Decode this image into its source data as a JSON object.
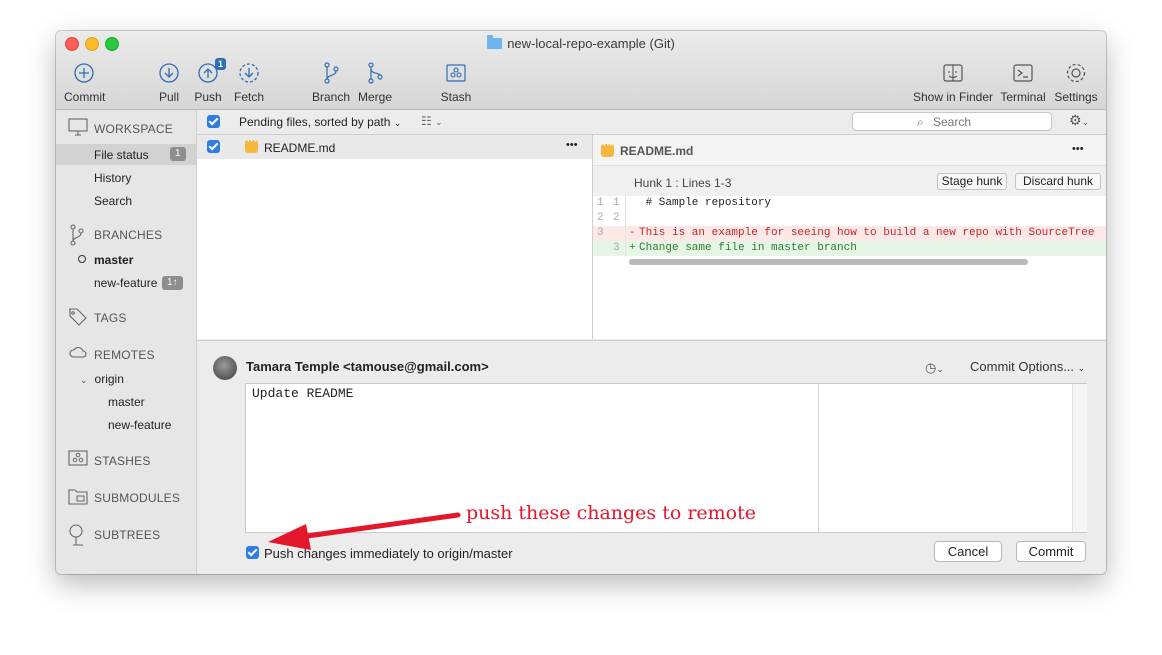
{
  "window": {
    "title": "new-local-repo-example (Git)"
  },
  "toolbar": {
    "commit": "Commit",
    "pull": "Pull",
    "push": "Push",
    "push_badge": "1",
    "fetch": "Fetch",
    "branch": "Branch",
    "merge": "Merge",
    "stash": "Stash",
    "show_in_finder": "Show in Finder",
    "terminal": "Terminal",
    "settings": "Settings"
  },
  "filterbar": {
    "sort_label": "Pending files, sorted by path",
    "search_placeholder": "Search"
  },
  "sidebar": {
    "workspace": "WORKSPACE",
    "file_status": "File status",
    "file_status_count": "1",
    "history": "History",
    "search": "Search",
    "branches": "BRANCHES",
    "branch_master": "master",
    "branch_new_feature": "new-feature",
    "branch_new_feature_badge": "1↑",
    "tags": "TAGS",
    "remotes": "REMOTES",
    "remote_origin": "origin",
    "remote_master": "master",
    "remote_new_feature": "new-feature",
    "stashes": "STASHES",
    "submodules": "SUBMODULES",
    "subtrees": "SUBTREES"
  },
  "files": {
    "row_name": "README.md",
    "more": "•••"
  },
  "diff": {
    "file_name": "README.md",
    "more": "•••",
    "hunk_title": "Hunk 1 : Lines 1-3",
    "stage_hunk": "Stage hunk",
    "discard_hunk": "Discard hunk",
    "lines": [
      {
        "old": "1",
        "new": "1",
        "sign": " ",
        "text": " # Sample repository"
      },
      {
        "old": "2",
        "new": "2",
        "sign": " ",
        "text": ""
      },
      {
        "old": "3",
        "new": "",
        "sign": "-",
        "text": "This is an example for seeing how to build a new repo with SourceTree"
      },
      {
        "old": "",
        "new": "3",
        "sign": "+",
        "text": "Change same file in master branch"
      }
    ]
  },
  "commit": {
    "author": "Tamara Temple <tamouse@gmail.com>",
    "options": "Commit Options...",
    "message": "Update README",
    "push_label": "Push changes immediately to origin/master",
    "cancel": "Cancel",
    "commit": "Commit"
  },
  "annotation": {
    "text": "push these changes to remote",
    "color": "#e3162b"
  }
}
